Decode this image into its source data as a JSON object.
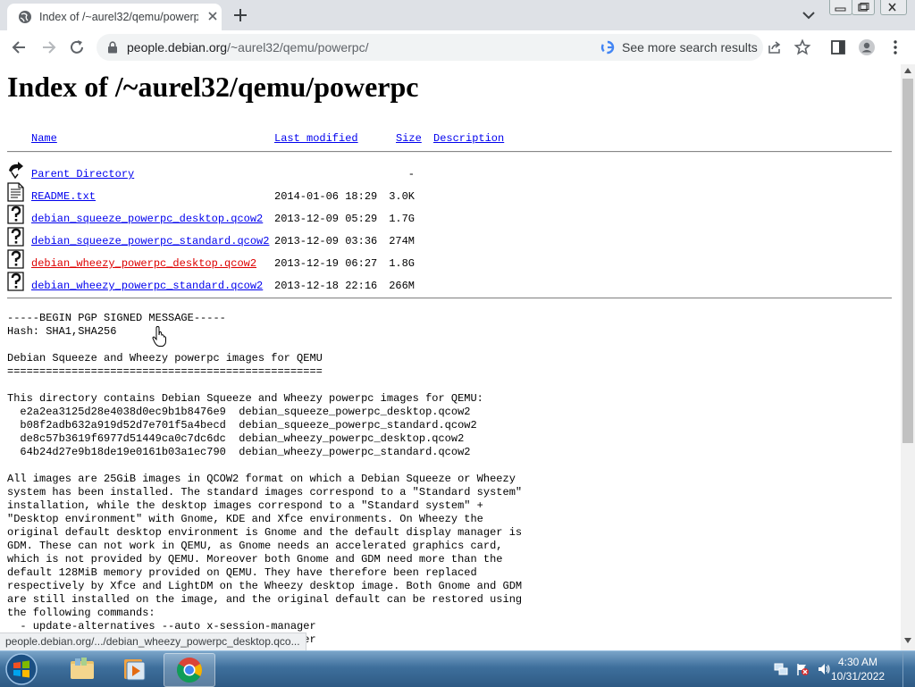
{
  "browser": {
    "tab_title": "Index of /~aurel32/qemu/powerpc",
    "url_host": "people.debian.org",
    "url_path": "/~aurel32/qemu/powerpc/",
    "search_hint": "See more search results"
  },
  "page": {
    "heading": "Index of /~aurel32/qemu/powerpc",
    "columns": {
      "name": "Name",
      "last_modified": "Last modified",
      "size": "Size",
      "description": "Description"
    },
    "rows": [
      {
        "name": "Parent Directory",
        "modified": "",
        "size": "-",
        "icon": "back-icon"
      },
      {
        "name": "README.txt",
        "modified": "2014-01-06 18:29",
        "size": "3.0K",
        "icon": "text-file-icon"
      },
      {
        "name": "debian_squeeze_powerpc_desktop.qcow2",
        "modified": "2013-12-09 05:29",
        "size": "1.7G",
        "icon": "unknown-file-icon"
      },
      {
        "name": "debian_squeeze_powerpc_standard.qcow2",
        "modified": "2013-12-09 03:36",
        "size": "274M",
        "icon": "unknown-file-icon"
      },
      {
        "name": "debian_wheezy_powerpc_desktop.qcow2",
        "modified": "2013-12-19 06:27",
        "size": "1.8G",
        "icon": "unknown-file-icon"
      },
      {
        "name": "debian_wheezy_powerpc_standard.qcow2",
        "modified": "2013-12-18 22:16",
        "size": "266M",
        "icon": "unknown-file-icon"
      }
    ],
    "readme_text": "-----BEGIN PGP SIGNED MESSAGE-----\nHash: SHA1,SHA256\n\nDebian Squeeze and Wheezy powerpc images for QEMU\n=================================================\n\nThis directory contains Debian Squeeze and Wheezy powerpc images for QEMU:\n  e2a2ea3125d28e4038d0ec9b1b8476e9  debian_squeeze_powerpc_desktop.qcow2\n  b08f2adb632a919d52d7e701f5a4becd  debian_squeeze_powerpc_standard.qcow2\n  de8c57b3619f6977d51449ca0c7dc6dc  debian_wheezy_powerpc_desktop.qcow2\n  64b24d27e9b18de19e0161b03a1ec790  debian_wheezy_powerpc_standard.qcow2\n\nAll images are 25GiB images in QCOW2 format on which a Debian Squeeze or Wheezy\nsystem has been installed. The standard images correspond to a \"Standard system\"\ninstallation, while the desktop images correspond to a \"Standard system\" +\n\"Desktop environment\" with Gnome, KDE and Xfce environments. On Wheezy the\noriginal default desktop environment is Gnome and the default display manager is\nGDM. These can not work in QEMU, as Gnome needs an accelerated graphics card,\nwhich is not provided by QEMU. Moreover both Gnome and GDM need more than the\ndefault 128MiB memory provided on QEMU. They have therefore been replaced\nrespectively by Xfce and LightDM on the Wheezy desktop image. Both Gnome and GDM\nare still installed on the image, and the original default can be restored using\nthe following commands:\n  - update-alternatives --auto x-session-manager\n  - update-alternatives --auto x-display-manager"
  },
  "status_bar": {
    "link": "people.debian.org/.../debian_wheezy_powerpc_desktop.qco..."
  },
  "taskbar": {
    "time": "4:30 AM",
    "date": "10/31/2022"
  }
}
